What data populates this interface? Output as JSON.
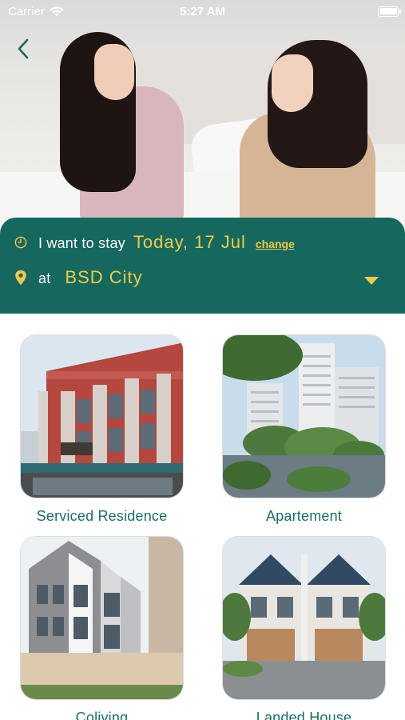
{
  "status_bar": {
    "carrier": "Carrier",
    "time": "5:27 AM"
  },
  "booking": {
    "stay_label": "I want to stay",
    "date": "Today, 17 Jul",
    "change_label": "change",
    "at_label": "at",
    "location": "BSD City"
  },
  "categories": [
    {
      "label": "Serviced Residence"
    },
    {
      "label": "Apartement"
    },
    {
      "label": "Coliving"
    },
    {
      "label": "Landed House"
    }
  ],
  "colors": {
    "primary": "#15685d",
    "accent": "#f2c94c",
    "caption": "#1a6e62"
  },
  "icons": {
    "back": "chevron-left-icon",
    "clock": "clock-icon",
    "location": "location-pin-icon",
    "dropdown": "caret-down-icon"
  }
}
